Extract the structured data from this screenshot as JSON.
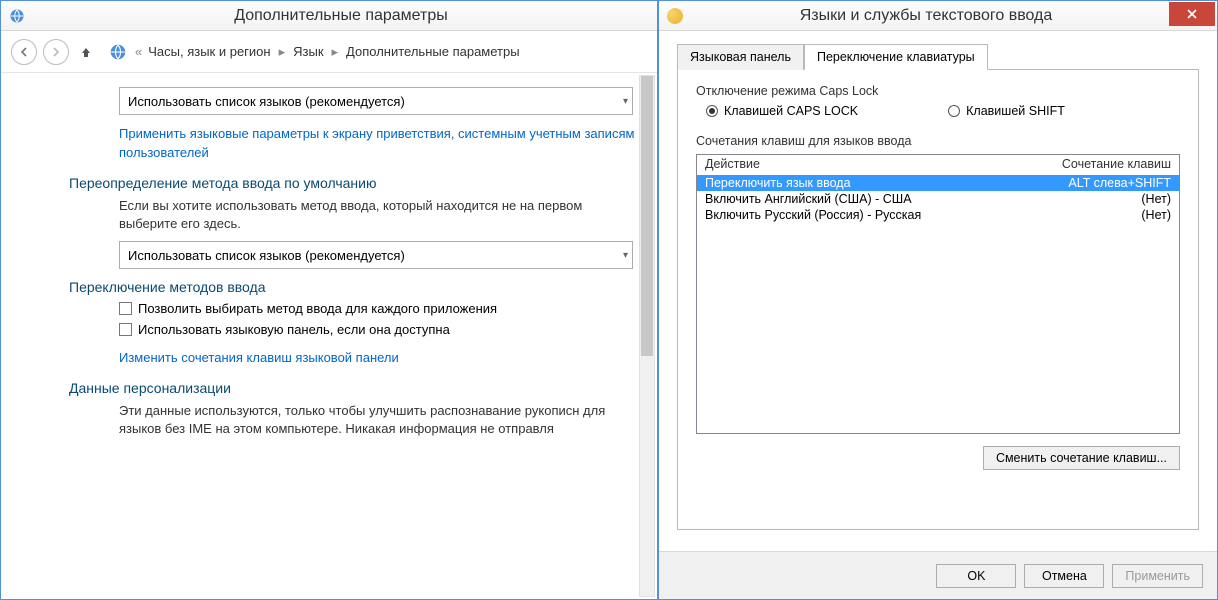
{
  "cp": {
    "title": "Дополнительные параметры",
    "crumbs": {
      "c1": "Часы, язык и регион",
      "c2": "Язык",
      "c3": "Дополнительные параметры"
    },
    "dropdown1": "Использовать список языков (рекомендуется)",
    "link_welcome": "Применить языковые параметры к экрану приветствия, системным учетным записям пользователей",
    "section_override": "Переопределение метода ввода по умолчанию",
    "para_override": "Если вы хотите использовать метод ввода, который находится не на первом выберите его здесь.",
    "dropdown2": "Использовать список языков (рекомендуется)",
    "section_switch": "Переключение методов ввода",
    "chk1": "Позволить выбирать метод ввода для каждого приложения",
    "chk2": "Использовать языковую панель, если она доступна",
    "link_hotkeys": "Изменить сочетания клавиш языковой панели",
    "section_personal": "Данные персонализации",
    "para_personal": "Эти данные используются, только чтобы улучшить распознавание рукописн для языков без IME на этом компьютере. Никакая информация не отправля"
  },
  "dlg": {
    "title": "Языки и службы текстового ввода",
    "tabs": {
      "panel": "Языковая панель",
      "switch": "Переключение клавиатуры"
    },
    "caps_group": "Отключение режима Caps Lock",
    "radio_caps": "Клавишей CAPS LOCK",
    "radio_shift": "Клавишей SHIFT",
    "hotkey_group": "Сочетания клавиш для языков ввода",
    "col_action": "Действие",
    "col_keys": "Сочетание клавиш",
    "rows": {
      "r0a": "Переключить язык ввода",
      "r0k": "ALT слева+SHIFT",
      "r1a": "Включить Английский (США) - США",
      "r1k": "(Нет)",
      "r2a": "Включить Русский (Россия) - Русская",
      "r2k": "(Нет)"
    },
    "btn_change": "Сменить сочетание клавиш...",
    "btn_ok": "OK",
    "btn_cancel": "Отмена",
    "btn_apply": "Применить"
  }
}
